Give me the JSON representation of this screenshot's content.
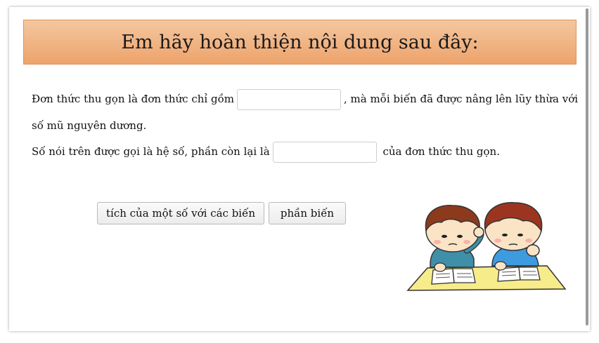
{
  "title": "Em hãy hoàn thiện nội dung sau đây:",
  "sentence1": {
    "before": "Đơn thức thu gọn là đơn thức chỉ gồm",
    "after": ", mà mỗi biến đã được nâng lên lũy thừa với",
    "continuation": "số mũ nguyên dương."
  },
  "sentence2": {
    "before": "Số nói trên được gọi là hệ số, phần còn lại là",
    "after": "của đơn thức thu gọn."
  },
  "choices": [
    "tích của một số với các biến",
    "phần biến"
  ],
  "colors": {
    "header_top": "#f4c7a0",
    "header_bottom": "#eda36b"
  }
}
